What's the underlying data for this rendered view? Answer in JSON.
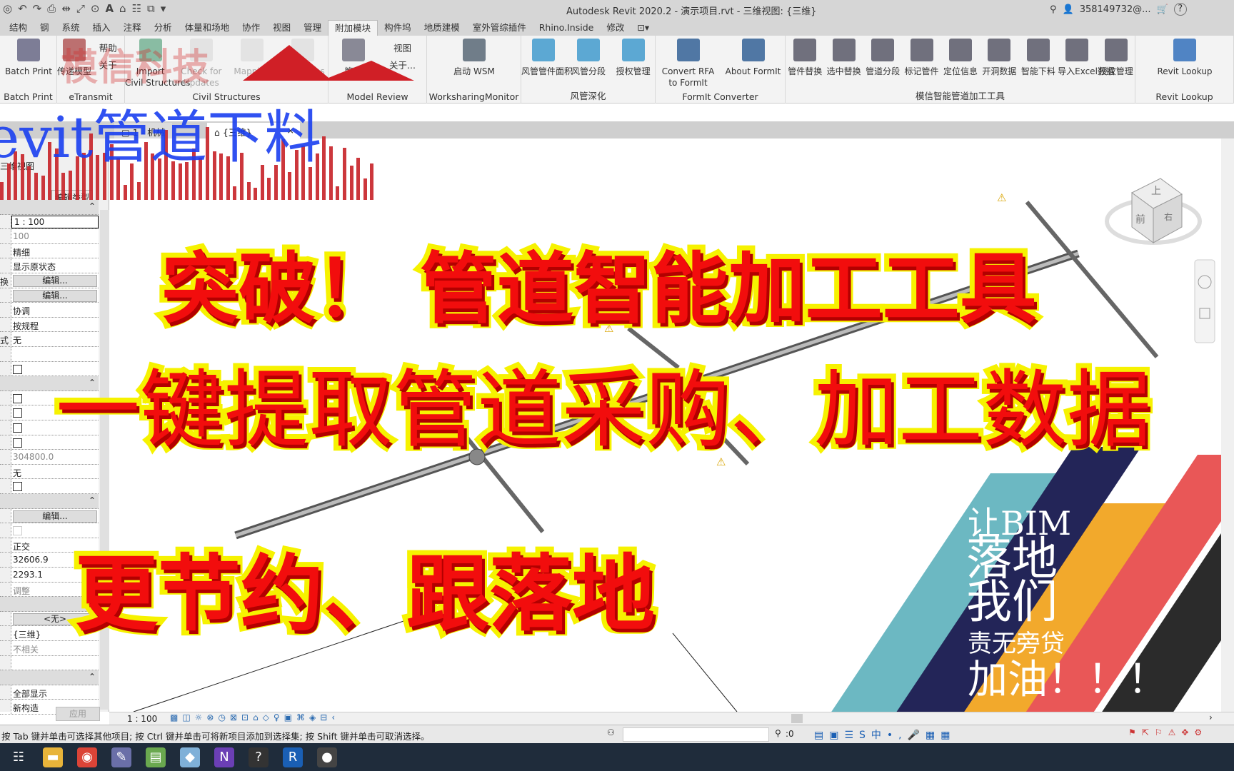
{
  "titlebar": {
    "title": "Autodesk Revit 2020.2 - 演示项目.rvt - 三维视图: {三维}",
    "user": "358149732@...",
    "help": "?"
  },
  "tabs": [
    "结构",
    "钢",
    "系统",
    "插入",
    "注释",
    "分析",
    "体量和场地",
    "协作",
    "视图",
    "管理",
    "附加模块",
    "构件坞",
    "地质建模",
    "室外管综插件",
    "Rhino.Inside",
    "修改"
  ],
  "active_tab": "附加模块",
  "ribbon": {
    "panels": [
      {
        "title": "Batch Print",
        "buttons": [
          "Batch Print"
        ]
      },
      {
        "title": "eTransmit",
        "buttons": [
          "传递模型"
        ],
        "small": [
          "帮助",
          "关于"
        ]
      },
      {
        "title": "Civil Structures",
        "buttons": [
          "Import\nCivil Structures",
          "Check for\nUpdates",
          "Mapping",
          "Properties"
        ]
      },
      {
        "title": "Model Review",
        "buttons": [
          "管理"
        ],
        "small": [
          "视图",
          "关于..."
        ]
      },
      {
        "title": "WorksharingMonitor",
        "buttons": [
          "启动 WSM"
        ]
      },
      {
        "title": "风管深化",
        "buttons": [
          "风管管件面积",
          "风管分段",
          "授权管理"
        ]
      },
      {
        "title": "FormIt Converter",
        "buttons": [
          "Convert RFA\nto FormIt",
          "About FormIt"
        ]
      },
      {
        "title": "模信智能管道加工工具",
        "buttons": [
          "管件替换",
          "选中替换",
          "管道分段",
          "标记管件",
          "定位信息",
          "开洞数据",
          "智能下料",
          "导入Excel数据",
          "授权管理"
        ]
      },
      {
        "title": "Revit Lookup",
        "buttons": [
          "Revit Lookup"
        ]
      }
    ]
  },
  "view_tabs": [
    {
      "label": "1 - 机械"
    },
    {
      "label": "{三维}",
      "close": "×"
    }
  ],
  "properties": {
    "view_selector": "三维视图",
    "edit_type": "编辑类型",
    "rows": [
      {
        "t": "grp"
      },
      {
        "v": "1 : 100",
        "k": "box"
      },
      {
        "v": "100",
        "k": "gray"
      },
      {
        "v": "精细"
      },
      {
        "v": "显示原状态"
      },
      {
        "l": "换",
        "v": "编辑...",
        "k": "btn"
      },
      {
        "v": "编辑...",
        "k": "btn"
      },
      {
        "v": "协调"
      },
      {
        "v": "按规程"
      },
      {
        "l": "式",
        "v": "无"
      },
      {
        "v": ""
      },
      {
        "k": "cb"
      },
      {
        "t": "grp"
      },
      {
        "k": "cb"
      },
      {
        "k": "cb"
      },
      {
        "k": "cb"
      },
      {
        "k": "cb"
      },
      {
        "v": "304800.0",
        "k": "gray"
      },
      {
        "v": "无"
      },
      {
        "k": "cb"
      },
      {
        "t": "grp"
      },
      {
        "v": "编辑...",
        "k": "btn"
      },
      {
        "k": "cbd"
      },
      {
        "v": "正交"
      },
      {
        "v": "32606.9"
      },
      {
        "v": "2293.1"
      },
      {
        "v": "调整",
        "k": "gray"
      },
      {
        "t": "grp"
      },
      {
        "v": "<无>",
        "k": "btn"
      },
      {
        "v": "{三维}"
      },
      {
        "v": "不相关",
        "k": "gray"
      },
      {
        "v": ""
      },
      {
        "t": "grp"
      },
      {
        "v": "全部显示"
      },
      {
        "v": "新构造"
      }
    ],
    "apply": "应用"
  },
  "viewbar": {
    "scale": "1 : 100"
  },
  "status": {
    "text": "按 Tab 键并单击可选择其他项目; 按 Ctrl 键并单击可将新项目添加到选择集; 按 Shift 键并单击可取消选择。",
    "count": ":0"
  },
  "viewcube": {
    "top": "上",
    "front": "前",
    "right": "右"
  },
  "overlay": {
    "watermark": "模信科技",
    "blue_title": "evit管道下料",
    "line1": "突破！ 管道智能加工工具",
    "line2": "一键提取管道采购、加工数据",
    "line3": "更节约、跟落地",
    "slogan": [
      "让BIM",
      "落地",
      "我们",
      "责无旁贷",
      "加油！！！"
    ],
    "stripe_colors": [
      "#6cb8c2",
      "#232558",
      "#f2a92c",
      "#e95757",
      "#2b2b2b"
    ],
    "accent_red": "#f20d0d",
    "accent_yellow": "#f6f200"
  },
  "taskbar": {
    "icons": [
      "task-view-icon",
      "file-explorer-icon",
      "chrome-icon",
      "paint-icon",
      "notepad-icon",
      "app-icon",
      "visual-studio-icon",
      "help-file-icon",
      "revit-icon",
      "obs-icon"
    ]
  }
}
